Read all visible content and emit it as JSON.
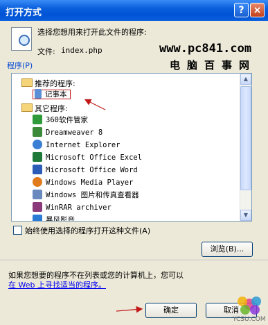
{
  "window": {
    "title": "打开方式",
    "help_glyph": "?",
    "close_glyph": "×"
  },
  "header": {
    "prompt": "选择您想用来打开此文件的程序:",
    "file_label": "文件:",
    "file_name": "index.php"
  },
  "watermark": {
    "site": "www.pc841.com",
    "name": "电脑百事网"
  },
  "programs": {
    "label": "程序(P)",
    "recommended_label": "推荐的程序:",
    "recommended": [
      {
        "name": "记事本",
        "icon": "notepad-icon"
      }
    ],
    "other_label": "其它程序:",
    "other": [
      {
        "name": "360软件管家",
        "icon": "360-icon"
      },
      {
        "name": "Dreamweaver 8",
        "icon": "dreamweaver-icon"
      },
      {
        "name": "Internet Explorer",
        "icon": "ie-icon"
      },
      {
        "name": "Microsoft Office Excel",
        "icon": "excel-icon"
      },
      {
        "name": "Microsoft Office Word",
        "icon": "word-icon"
      },
      {
        "name": "Windows Media Player",
        "icon": "media-player-icon"
      },
      {
        "name": "Windows 图片和传真查看器",
        "icon": "picture-viewer-icon"
      },
      {
        "name": "WinRAR archiver",
        "icon": "winrar-icon"
      },
      {
        "name": "暴风影音",
        "icon": "storm-player-icon"
      }
    ]
  },
  "always_use": {
    "label": "始终使用选择的程序打开这种文件(A)",
    "checked": false
  },
  "browse_label": "浏览(B)...",
  "info": {
    "line1": "如果您想要的程序不在列表或您的计算机上，您可以",
    "link": "在 Web 上寻找适当的程序。"
  },
  "buttons": {
    "ok": "确定",
    "cancel": "取消"
  },
  "corner_watermark": "YCSU.COM",
  "colors": {
    "titlebar": "#0a5fdc",
    "annotation_arrow": "#c01818",
    "link": "#0000ee"
  }
}
